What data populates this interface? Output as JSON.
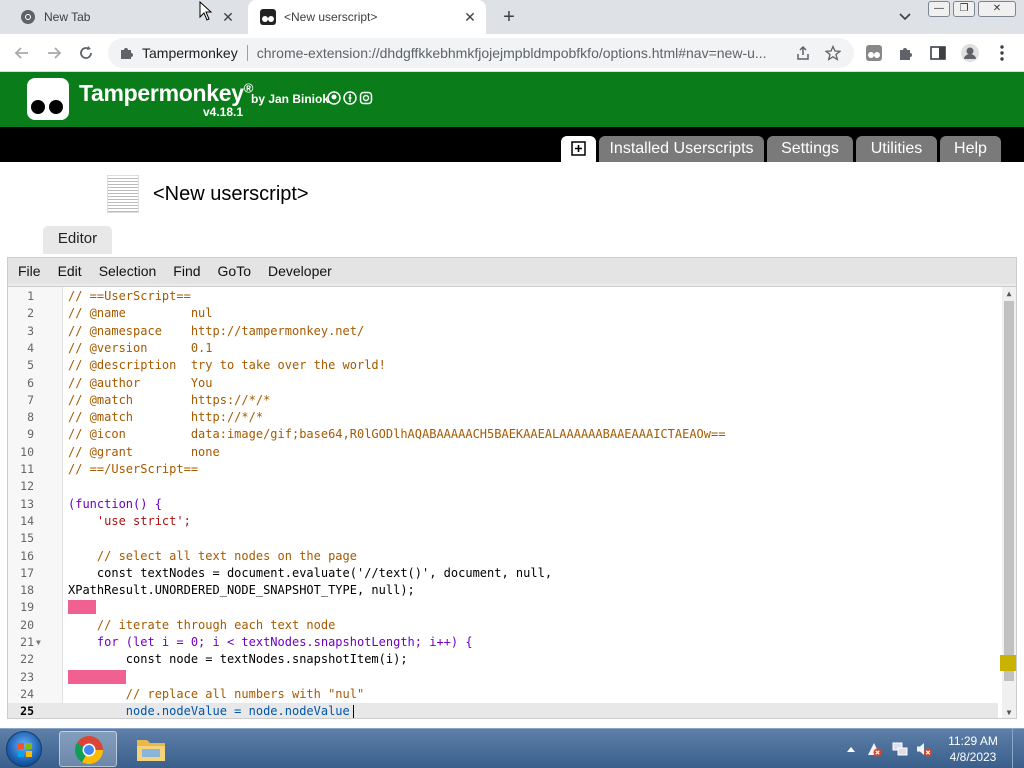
{
  "browser": {
    "tabs": [
      {
        "label": "New Tab"
      },
      {
        "label": "<New userscript>"
      }
    ],
    "omnibox": {
      "site": "Tampermonkey",
      "url": "chrome-extension://dhdgffkkebhmkfjojejmpbldmpobfkfo/options.html#nav=new-u..."
    }
  },
  "tm": {
    "title": "Tampermonkey",
    "registered": "®",
    "by": "by Jan Biniok",
    "version": "v4.18.1",
    "nav": [
      "Installed Userscripts",
      "Settings",
      "Utilities",
      "Help"
    ]
  },
  "script": {
    "title": "<New userscript>",
    "editor_tab": "Editor"
  },
  "menu": [
    "File",
    "Edit",
    "Selection",
    "Find",
    "GoTo",
    "Developer"
  ],
  "code": {
    "line_numbers": [
      "1",
      "2",
      "3",
      "4",
      "5",
      "6",
      "7",
      "8",
      "9",
      "10",
      "11",
      "12",
      "13",
      "14",
      "15",
      "16",
      "17",
      "18",
      "19",
      "20",
      "21",
      "22",
      "23",
      "24",
      "25"
    ],
    "lines": [
      "// ==UserScript==",
      "// @name         nul",
      "// @namespace    http://tampermonkey.net/",
      "// @version      0.1",
      "// @description  try to take over the world!",
      "// @author       You",
      "// @match        https://*/*",
      "// @match        http://*/*",
      "// @icon         data:image/gif;base64,R0lGODlhAQABAAAAACH5BAEKAAEALAAAAAABAAEAAAICTAEAOw==",
      "// @grant        none",
      "// ==/UserScript==",
      "",
      "(function() {",
      "    'use strict';",
      "",
      "    // select all text nodes on the page",
      "    const textNodes = document.evaluate('//text()', document, null,",
      "XPathResult.UNORDERED_NODE_SNAPSHOT_TYPE, null);",
      "",
      "    // iterate through each text node",
      "    for (let i = 0; i < textNodes.snapshotLength; i++) {",
      "        const node = textNodes.snapshotItem(i);",
      "",
      "        // replace all numbers with \"nul\"",
      "        node.nodeValue = node.nodeValue"
    ]
  },
  "taskbar": {
    "time": "11:29 AM",
    "date": "4/8/2023"
  },
  "colors": {
    "tm_green": "#0a7d1a",
    "nav_tab": "#7a7a7a",
    "lint_error": "#f06090",
    "scroll_marker": "#c9b200"
  }
}
